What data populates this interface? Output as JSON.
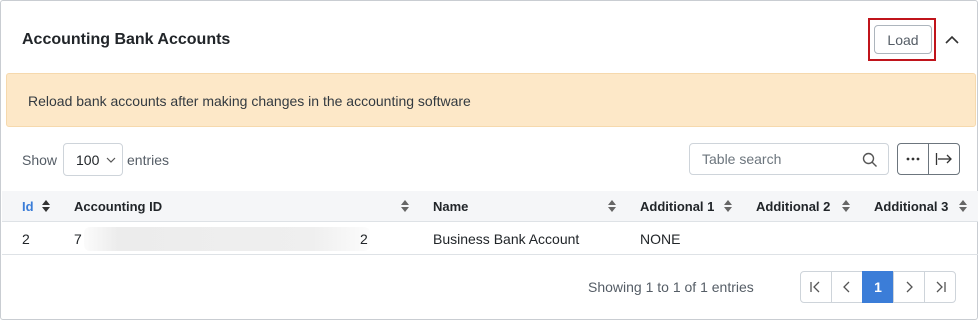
{
  "card": {
    "title": "Accounting Bank Accounts",
    "load_label": "Load",
    "collapse_icon": "chevron-up-icon"
  },
  "alert": {
    "text": "Reload bank accounts after making changes in the accounting software"
  },
  "controls": {
    "show_label": "Show",
    "page_length": "100",
    "entries_label": "entries",
    "search_placeholder": "Table search",
    "more_icon": "ellipsis-icon",
    "export_icon": "arrow-right-bar-icon"
  },
  "table": {
    "columns": [
      "Id",
      "Accounting ID",
      "Name",
      "Additional 1",
      "Additional 2",
      "Additional 3"
    ],
    "rows": [
      {
        "id": "2",
        "accounting_id_start": "7",
        "accounting_id_end": "2",
        "name": "Business Bank Account",
        "additional_1": "NONE",
        "additional_2": "",
        "additional_3": ""
      }
    ]
  },
  "footer": {
    "info": "Showing 1 to 1 of 1 entries",
    "current_page": "1"
  },
  "colors": {
    "accent": "#3b7dd8",
    "alert_bg": "#fde8c8",
    "highlight": "#c0141b"
  }
}
